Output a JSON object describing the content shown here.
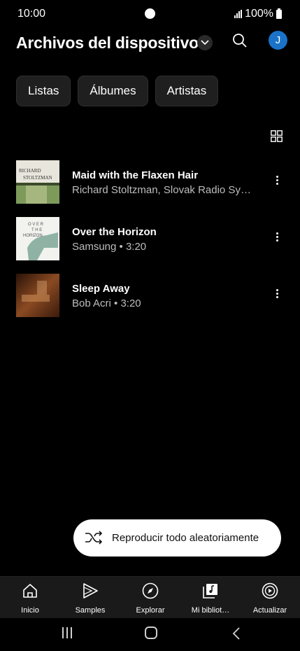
{
  "status_bar": {
    "time": "10:00",
    "battery": "100%"
  },
  "header": {
    "title": "Archivos del dispositivo",
    "avatar_initial": "J"
  },
  "chips": [
    "Listas",
    "Álbumes",
    "Artistas"
  ],
  "tracks": [
    {
      "title": "Maid with the Flaxen Hair",
      "subtitle": "Richard Stoltzman, Slovak Radio Sym…",
      "art": "richard-stoltzman-cover"
    },
    {
      "title": "Over the Horizon",
      "subtitle": "Samsung • 3:20",
      "art": "over-the-horizon-cover"
    },
    {
      "title": "Sleep Away",
      "subtitle": "Bob Acri • 3:20",
      "art": "sleep-away-cover"
    }
  ],
  "art_text": {
    "cover1_line1": "RICHARD",
    "cover1_line2": "STOLTZMAN",
    "cover2_line1": "O V E R",
    "cover2_line2": "T H E",
    "cover2_line3": "HORIZON"
  },
  "shuffle": {
    "label": "Reproducir todo aleatoriamente"
  },
  "bottom_nav": [
    {
      "label": "Inicio",
      "icon": "home-icon"
    },
    {
      "label": "Samples",
      "icon": "play-outline-icon"
    },
    {
      "label": "Explorar",
      "icon": "compass-icon"
    },
    {
      "label": "Mi bibliot…",
      "icon": "library-music-icon"
    },
    {
      "label": "Actualizar",
      "icon": "upgrade-play-icon"
    }
  ],
  "colors": {
    "background": "#000000",
    "avatar": "#1a73c8",
    "chip": "#1f1f1f",
    "nav_bg": "#1a1a1a"
  }
}
